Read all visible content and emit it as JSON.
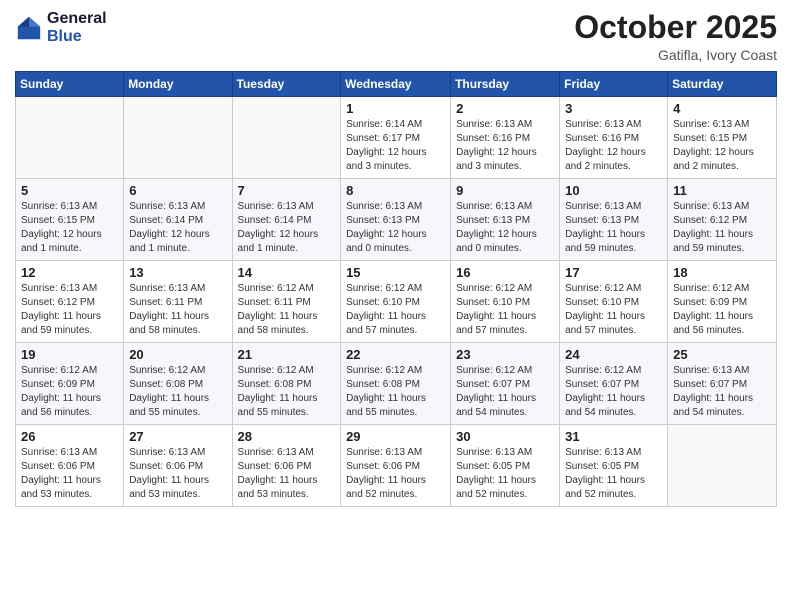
{
  "logo": {
    "line1": "General",
    "line2": "Blue"
  },
  "title": "October 2025",
  "subtitle": "Gatifla, Ivory Coast",
  "days_header": [
    "Sunday",
    "Monday",
    "Tuesday",
    "Wednesday",
    "Thursday",
    "Friday",
    "Saturday"
  ],
  "weeks": [
    [
      {
        "day": "",
        "info": ""
      },
      {
        "day": "",
        "info": ""
      },
      {
        "day": "",
        "info": ""
      },
      {
        "day": "1",
        "info": "Sunrise: 6:14 AM\nSunset: 6:17 PM\nDaylight: 12 hours and 3 minutes."
      },
      {
        "day": "2",
        "info": "Sunrise: 6:13 AM\nSunset: 6:16 PM\nDaylight: 12 hours and 3 minutes."
      },
      {
        "day": "3",
        "info": "Sunrise: 6:13 AM\nSunset: 6:16 PM\nDaylight: 12 hours and 2 minutes."
      },
      {
        "day": "4",
        "info": "Sunrise: 6:13 AM\nSunset: 6:15 PM\nDaylight: 12 hours and 2 minutes."
      }
    ],
    [
      {
        "day": "5",
        "info": "Sunrise: 6:13 AM\nSunset: 6:15 PM\nDaylight: 12 hours and 1 minute."
      },
      {
        "day": "6",
        "info": "Sunrise: 6:13 AM\nSunset: 6:14 PM\nDaylight: 12 hours and 1 minute."
      },
      {
        "day": "7",
        "info": "Sunrise: 6:13 AM\nSunset: 6:14 PM\nDaylight: 12 hours and 1 minute."
      },
      {
        "day": "8",
        "info": "Sunrise: 6:13 AM\nSunset: 6:13 PM\nDaylight: 12 hours and 0 minutes."
      },
      {
        "day": "9",
        "info": "Sunrise: 6:13 AM\nSunset: 6:13 PM\nDaylight: 12 hours and 0 minutes."
      },
      {
        "day": "10",
        "info": "Sunrise: 6:13 AM\nSunset: 6:13 PM\nDaylight: 11 hours and 59 minutes."
      },
      {
        "day": "11",
        "info": "Sunrise: 6:13 AM\nSunset: 6:12 PM\nDaylight: 11 hours and 59 minutes."
      }
    ],
    [
      {
        "day": "12",
        "info": "Sunrise: 6:13 AM\nSunset: 6:12 PM\nDaylight: 11 hours and 59 minutes."
      },
      {
        "day": "13",
        "info": "Sunrise: 6:13 AM\nSunset: 6:11 PM\nDaylight: 11 hours and 58 minutes."
      },
      {
        "day": "14",
        "info": "Sunrise: 6:12 AM\nSunset: 6:11 PM\nDaylight: 11 hours and 58 minutes."
      },
      {
        "day": "15",
        "info": "Sunrise: 6:12 AM\nSunset: 6:10 PM\nDaylight: 11 hours and 57 minutes."
      },
      {
        "day": "16",
        "info": "Sunrise: 6:12 AM\nSunset: 6:10 PM\nDaylight: 11 hours and 57 minutes."
      },
      {
        "day": "17",
        "info": "Sunrise: 6:12 AM\nSunset: 6:10 PM\nDaylight: 11 hours and 57 minutes."
      },
      {
        "day": "18",
        "info": "Sunrise: 6:12 AM\nSunset: 6:09 PM\nDaylight: 11 hours and 56 minutes."
      }
    ],
    [
      {
        "day": "19",
        "info": "Sunrise: 6:12 AM\nSunset: 6:09 PM\nDaylight: 11 hours and 56 minutes."
      },
      {
        "day": "20",
        "info": "Sunrise: 6:12 AM\nSunset: 6:08 PM\nDaylight: 11 hours and 55 minutes."
      },
      {
        "day": "21",
        "info": "Sunrise: 6:12 AM\nSunset: 6:08 PM\nDaylight: 11 hours and 55 minutes."
      },
      {
        "day": "22",
        "info": "Sunrise: 6:12 AM\nSunset: 6:08 PM\nDaylight: 11 hours and 55 minutes."
      },
      {
        "day": "23",
        "info": "Sunrise: 6:12 AM\nSunset: 6:07 PM\nDaylight: 11 hours and 54 minutes."
      },
      {
        "day": "24",
        "info": "Sunrise: 6:12 AM\nSunset: 6:07 PM\nDaylight: 11 hours and 54 minutes."
      },
      {
        "day": "25",
        "info": "Sunrise: 6:13 AM\nSunset: 6:07 PM\nDaylight: 11 hours and 54 minutes."
      }
    ],
    [
      {
        "day": "26",
        "info": "Sunrise: 6:13 AM\nSunset: 6:06 PM\nDaylight: 11 hours and 53 minutes."
      },
      {
        "day": "27",
        "info": "Sunrise: 6:13 AM\nSunset: 6:06 PM\nDaylight: 11 hours and 53 minutes."
      },
      {
        "day": "28",
        "info": "Sunrise: 6:13 AM\nSunset: 6:06 PM\nDaylight: 11 hours and 53 minutes."
      },
      {
        "day": "29",
        "info": "Sunrise: 6:13 AM\nSunset: 6:06 PM\nDaylight: 11 hours and 52 minutes."
      },
      {
        "day": "30",
        "info": "Sunrise: 6:13 AM\nSunset: 6:05 PM\nDaylight: 11 hours and 52 minutes."
      },
      {
        "day": "31",
        "info": "Sunrise: 6:13 AM\nSunset: 6:05 PM\nDaylight: 11 hours and 52 minutes."
      },
      {
        "day": "",
        "info": ""
      }
    ]
  ]
}
